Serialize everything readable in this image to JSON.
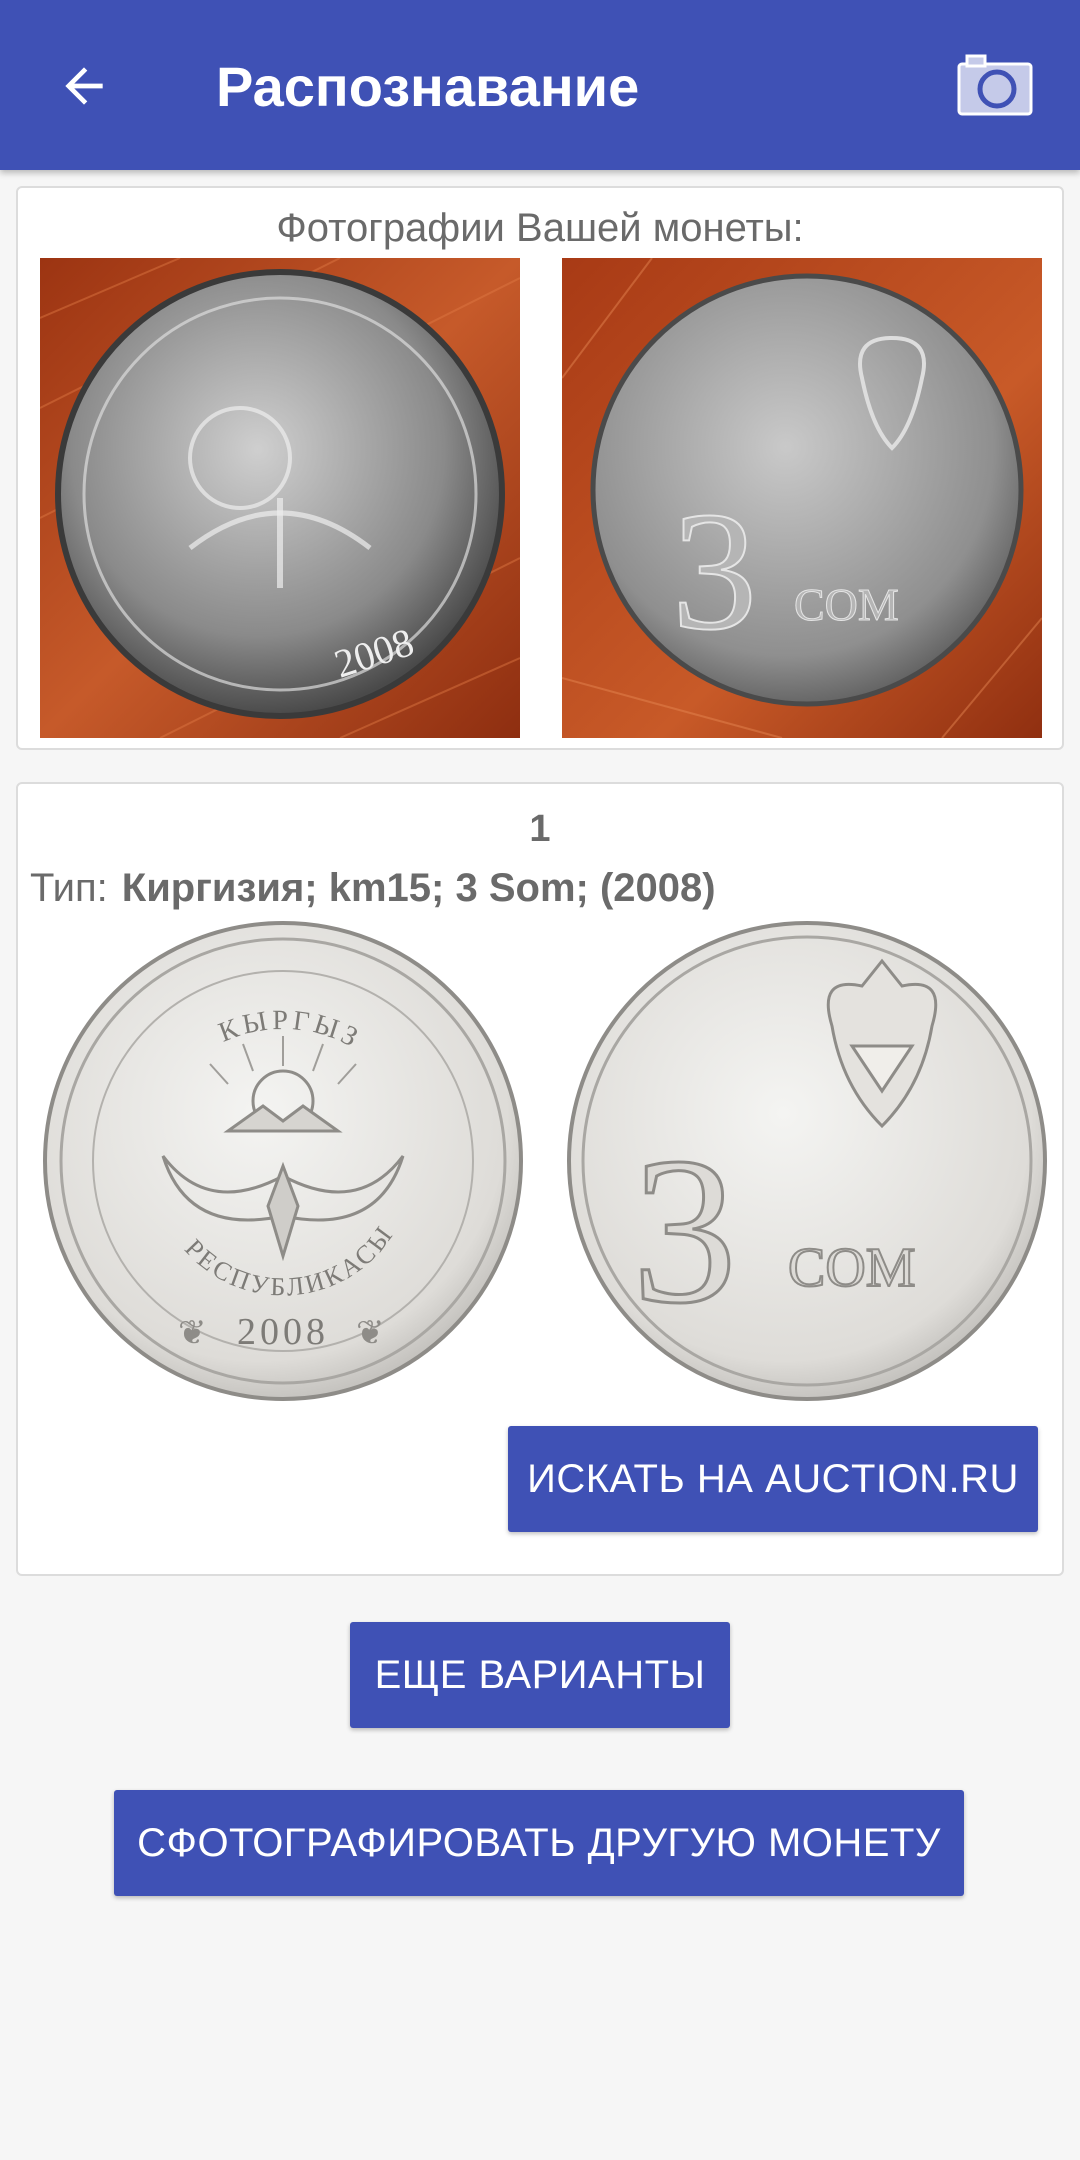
{
  "appbar": {
    "title": "Распознавание",
    "back_icon": "arrow-left-icon",
    "camera_icon": "camera-icon",
    "color": "#3f51b5"
  },
  "photo_card": {
    "caption": "Фотографии Вашей монеты:"
  },
  "user_coin": {
    "obverse_year": "2008",
    "reverse_denomination": "3",
    "reverse_unit": "СОМ"
  },
  "result": {
    "index": "1",
    "type_label": "Тип:",
    "type_value": "Киргизия; km15; 3 Som; (2008)",
    "obverse": {
      "top_legend": "КЫРГЫЗ",
      "bottom_legend": "РЕСПУБЛИКАСЫ",
      "year": "2008"
    },
    "reverse": {
      "denomination": "3",
      "unit": "СОМ"
    },
    "search_button": "ИСКАТЬ НА AUCTION.RU"
  },
  "actions": {
    "more_button": "ЕЩЕ ВАРИАНТЫ",
    "photo_other_button": "СФОТОГРАФИРОВАТЬ ДРУГУЮ МОНЕТУ"
  }
}
